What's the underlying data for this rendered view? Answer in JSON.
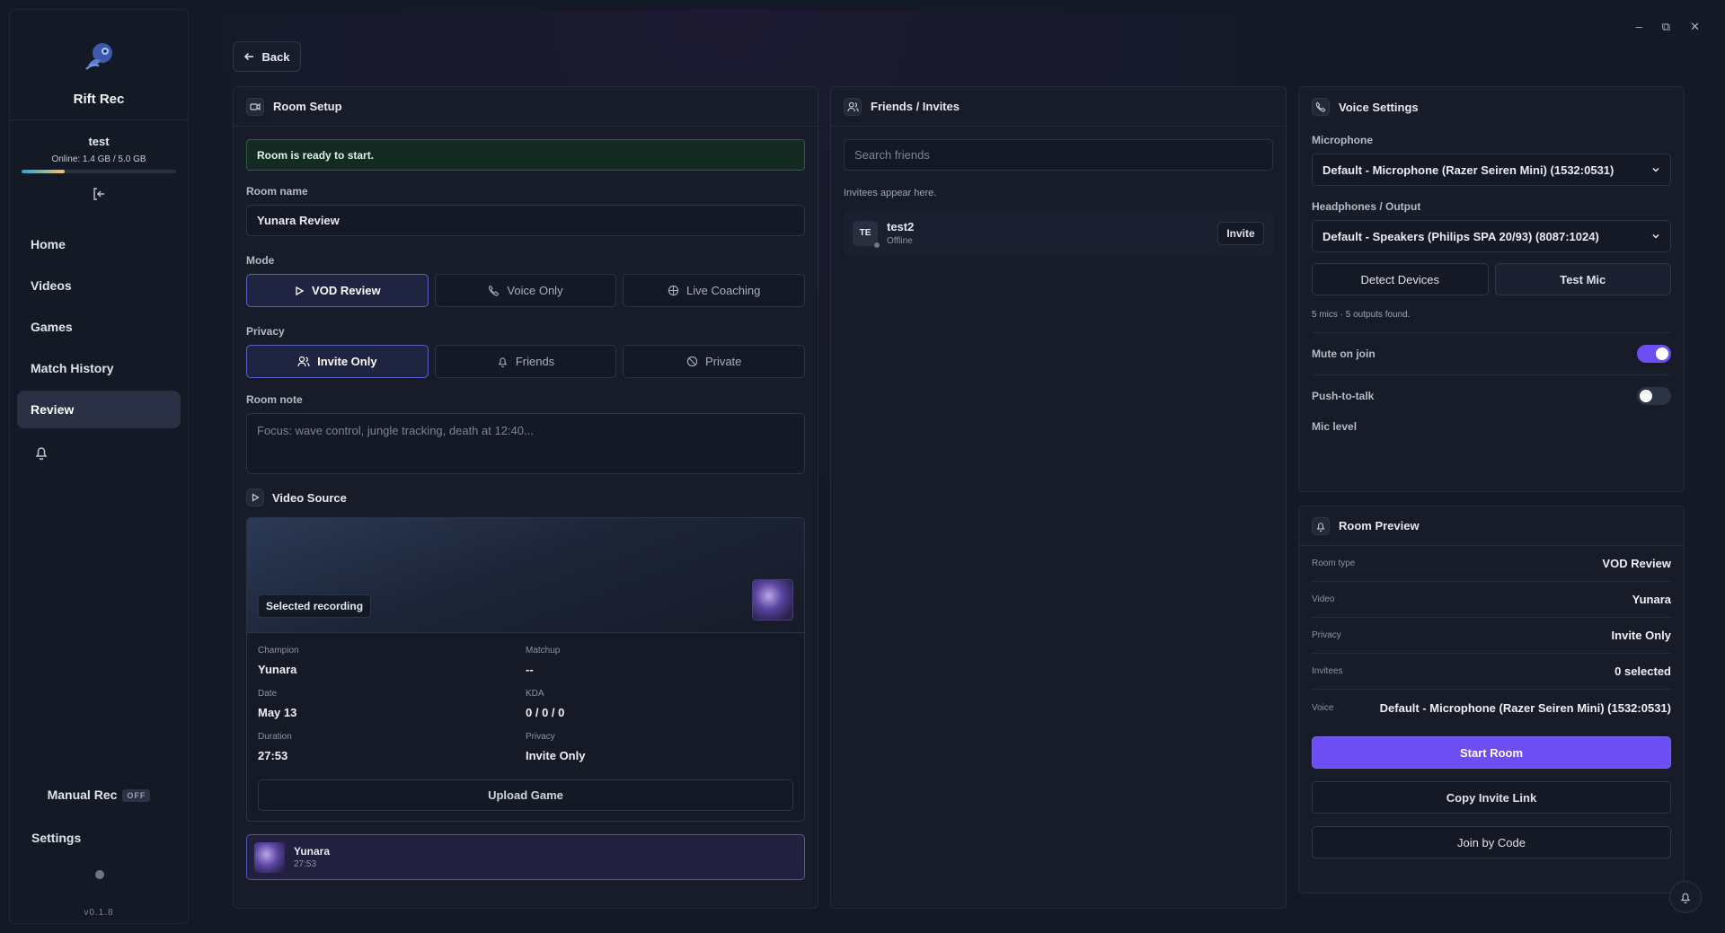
{
  "sidebar": {
    "app_name": "Rift Rec",
    "user": "test",
    "storage_text": "Online: 1.4 GB / 5.0 GB",
    "storage_fraction": 0.28,
    "nav": [
      {
        "label": "Home"
      },
      {
        "label": "Videos"
      },
      {
        "label": "Games"
      },
      {
        "label": "Match History"
      },
      {
        "label": "Review",
        "active": true
      }
    ],
    "manual_rec": "Manual Rec",
    "manual_rec_state": "OFF",
    "settings": "Settings",
    "version": "v0.1.8"
  },
  "window_controls": [
    "–",
    "⧉",
    "✕"
  ],
  "back_label": "Back",
  "room_setup": {
    "title": "Room Setup",
    "ready_text": "Room is ready to start.",
    "room_name_label": "Room name",
    "room_name_value": "Yunara Review",
    "mode_label": "Mode",
    "modes": [
      "VOD Review",
      "Voice Only",
      "Live Coaching"
    ],
    "privacy_label": "Privacy",
    "privacy_options": [
      "Invite Only",
      "Friends",
      "Private"
    ],
    "note_label": "Room note",
    "note_placeholder": "Focus: wave control, jungle tracking, death at 12:40...",
    "video_source_title": "Video Source",
    "selected_badge": "Selected recording",
    "details": {
      "champion_label": "Champion",
      "champion": "Yunara",
      "matchup_label": "Matchup",
      "matchup": "--",
      "date_label": "Date",
      "date": "May 13",
      "kda_label": "KDA",
      "kda": "0 / 0 / 0",
      "duration_label": "Duration",
      "duration": "27:53",
      "privacy_label": "Privacy",
      "privacy": "Invite Only"
    },
    "upload_label": "Upload Game",
    "recording": {
      "name": "Yunara",
      "duration": "27:53"
    }
  },
  "friends": {
    "title": "Friends / Invites",
    "search_placeholder": "Search friends",
    "hint": "Invitees appear here.",
    "list": [
      {
        "initials": "TE",
        "name": "test2",
        "status": "Offline",
        "action": "Invite"
      }
    ]
  },
  "voice": {
    "title": "Voice Settings",
    "mic_label": "Microphone",
    "mic_value": "Default - Microphone (Razer Seiren Mini) (1532:0531)",
    "out_label": "Headphones / Output",
    "out_value": "Default - Speakers (Philips SPA 20/93) (8087:1024)",
    "detect_label": "Detect Devices",
    "test_label": "Test Mic",
    "devices_found": "5 mics · 5 outputs found.",
    "mute_label": "Mute on join",
    "mute_on": true,
    "ptt_label": "Push-to-talk",
    "ptt_on": false,
    "mic_level_label": "Mic level"
  },
  "preview": {
    "title": "Room Preview",
    "rows": [
      {
        "k": "Room type",
        "v": "VOD Review"
      },
      {
        "k": "Video",
        "v": "Yunara"
      },
      {
        "k": "Privacy",
        "v": "Invite Only"
      },
      {
        "k": "Invitees",
        "v": "0 selected"
      },
      {
        "k": "Voice",
        "v": "Default - Microphone (Razer Seiren Mini) (1532:0531)"
      }
    ],
    "start_label": "Start Room",
    "copy_label": "Copy Invite Link",
    "join_label": "Join by Code"
  },
  "colors": {
    "accent": "#6c4ef2",
    "ready_bg": "#152a22",
    "panel": "#171c28"
  }
}
